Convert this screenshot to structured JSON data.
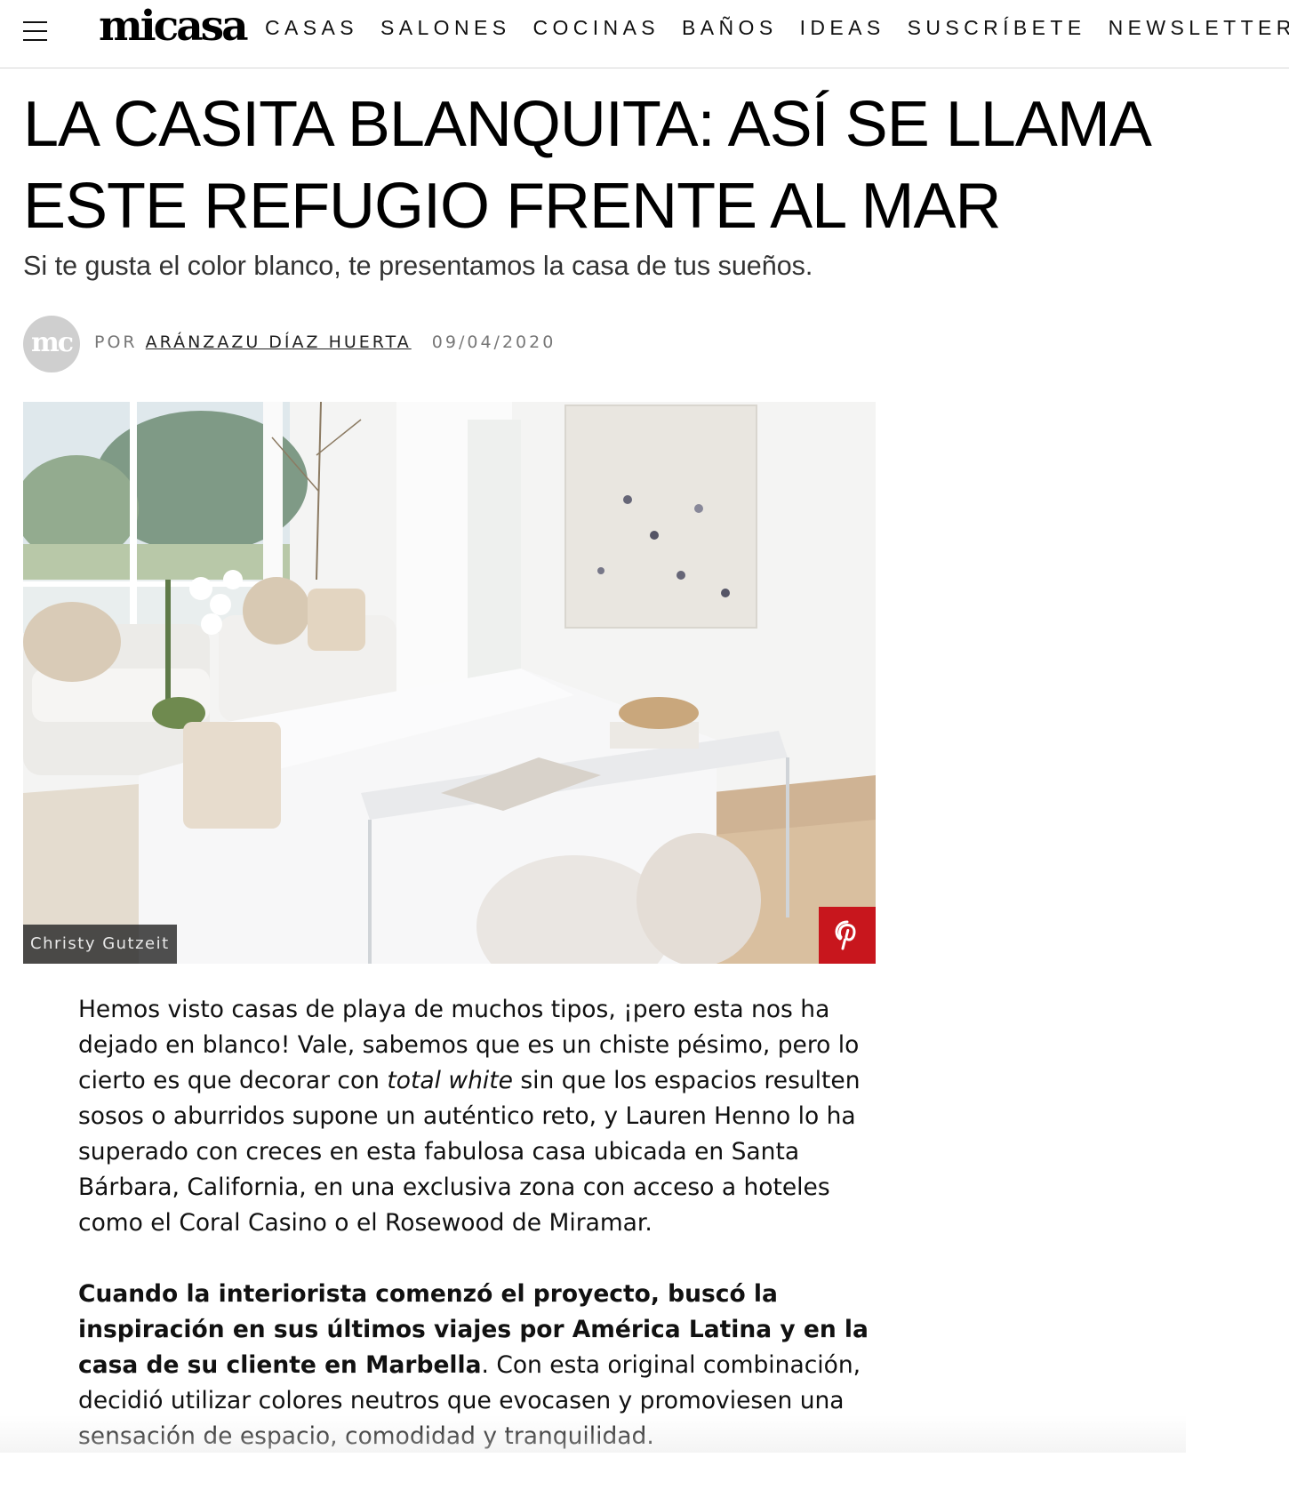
{
  "header": {
    "logo": "micasa",
    "nav": [
      "CASAS",
      "SALONES",
      "COCINAS",
      "BAÑOS",
      "IDEAS",
      "SUSCRÍBETE",
      "NEWSLETTER"
    ]
  },
  "article": {
    "title": "LA CASITA BLANQUITA: ASÍ SE LLAMA ESTE REFUGIO FRENTE AL MAR",
    "subtitle": "Si te gusta el color blanco, te presentamos la casa de tus sueños.",
    "avatar_text": "mc",
    "by_label": "POR",
    "author": "ARÁNZAZU DÍAZ HUERTA",
    "date": "09/04/2020",
    "image_credit": "Christy Gutzeit",
    "p1_part1": "Hemos visto casas de playa de muchos tipos, ¡pero esta nos ha dejado en blanco! Vale, sabemos que es un chiste pésimo, pero lo cierto es que decorar con ",
    "p1_italic": "total white",
    "p1_part2": " sin que los espacios resulten sosos o aburridos supone un auténtico reto, y Lauren Henno lo ha superado con creces en esta fabulosa casa ubicada en Santa Bárbara, California, en una exclusiva zona con acceso a hoteles como el Coral Casino o el Rosewood de Miramar.",
    "p2_bold": "Cuando la interiorista comenzó el proyecto, buscó la inspiración en sus últimos viajes por América Latina y en la casa de su cliente en Marbella",
    "p2_rest": ". Con esta original combinación, decidió utilizar colores neutros que evocasen y promoviesen una sensación de espacio, comodidad y tranquilidad."
  },
  "icons": {
    "menu": "hamburger-menu-icon",
    "pinterest": "pinterest-icon"
  },
  "colors": {
    "pinterest_red": "#c8161d",
    "divider": "#d6d6d6",
    "avatar_gray": "#cfcfcf"
  }
}
